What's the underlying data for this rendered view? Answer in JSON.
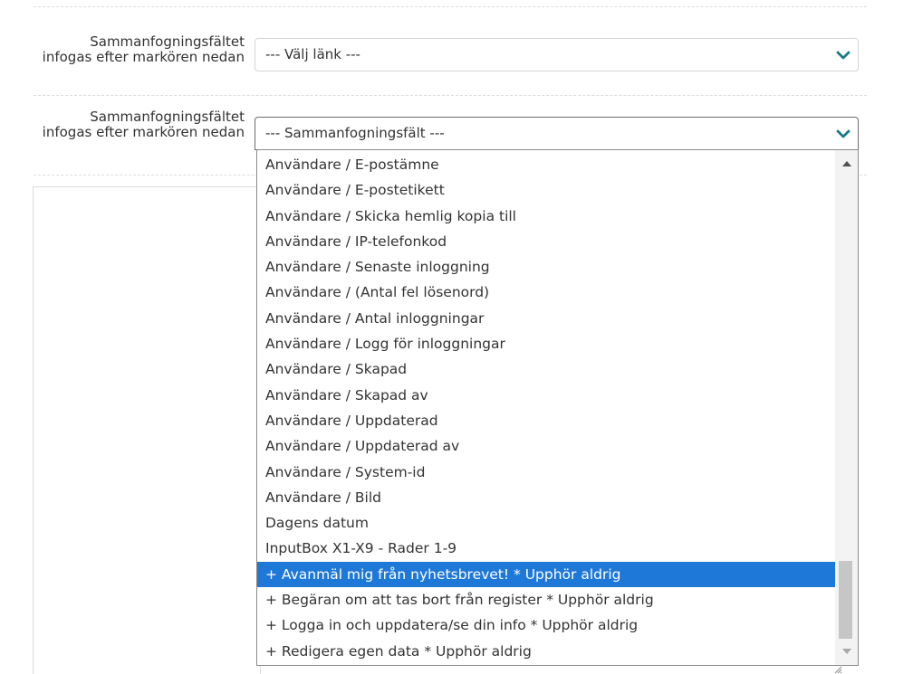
{
  "field1": {
    "label": "Sammanfogningsfältet infogas efter markören nedan",
    "value": "--- Välj länk ---",
    "icon": "chevron-down-icon"
  },
  "field2": {
    "label": "Sammanfogningsfältet infogas efter markören nedan",
    "value": "--- Sammanfogningsfält ---",
    "icon": "chevron-down-icon"
  },
  "dropdown": {
    "options": [
      "Användare / E-postämne",
      "Användare / E-postetikett",
      "Användare / Skicka hemlig kopia till",
      "Användare / IP-telefonkod",
      "Användare / Senaste inloggning",
      "Användare / (Antal fel lösenord)",
      "Användare / Antal inloggningar",
      "Användare / Logg för inloggningar",
      "Användare / Skapad",
      "Användare / Skapad av",
      "Användare / Uppdaterad",
      "Användare / Uppdaterad av",
      "Användare / System-id",
      "Användare / Bild",
      "Dagens datum",
      "InputBox X1-X9 - Rader 1-9",
      "+ Avanmäl mig från nyhetsbrevet! * Upphör aldrig",
      "+ Begäran om att tas bort från register * Upphör aldrig",
      "+ Logga in och uppdatera/se din info * Upphör aldrig",
      "+ Redigera egen data * Upphör aldrig"
    ],
    "selected_index": 16
  },
  "colors": {
    "accent": "#1e78d7",
    "chevron": "#1a7a86",
    "text": "#333333"
  }
}
